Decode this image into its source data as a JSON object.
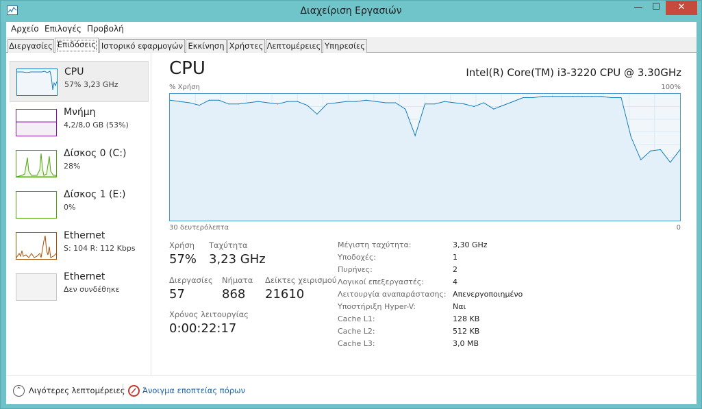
{
  "window": {
    "title": "Διαχείριση Εργασιών",
    "min_glyph": "—",
    "max_glyph": "☐",
    "close_glyph": "✕"
  },
  "menu": [
    {
      "label": "Αρχείο"
    },
    {
      "label": "Επιλογές"
    },
    {
      "label": "Προβολή"
    }
  ],
  "tabs": [
    {
      "label": "Διεργασίες",
      "active": false
    },
    {
      "label": "Επιδόσεις",
      "active": true
    },
    {
      "label": "Ιστορικό εφαρμογών",
      "active": false
    },
    {
      "label": "Εκκίνηση",
      "active": false
    },
    {
      "label": "Χρήστες",
      "active": false
    },
    {
      "label": "Λεπτομέρειες",
      "active": false
    },
    {
      "label": "Υπηρεσίες",
      "active": false
    }
  ],
  "sidebar": [
    {
      "name": "CPU",
      "sub": "57% 3,23 GHz",
      "color": "#117dbb",
      "icon": "cpu-thumbnail"
    },
    {
      "name": "Μνήμη",
      "sub": "4,2/8,0 GB (53%)",
      "color": "#8b12ae",
      "icon": "memory-thumbnail"
    },
    {
      "name": "Δίσκος 0 (C:)",
      "sub": "28%",
      "color": "#4da60c",
      "icon": "disk-thumbnail"
    },
    {
      "name": "Δίσκος 1 (E:)",
      "sub": "0%",
      "color": "#4da60c",
      "icon": "disk-thumbnail"
    },
    {
      "name": "Ethernet",
      "sub": "S: 104  R: 112 Kbps",
      "color": "#a74f01",
      "icon": "ethernet-thumbnail"
    },
    {
      "name": "Ethernet",
      "sub": "Δεν συνδέθηκε",
      "color": "#9c9c9c",
      "icon": "ethernet-thumbnail"
    }
  ],
  "cpu": {
    "title": "CPU",
    "model": "Intel(R) Core(TM) i3-3220 CPU @ 3.30GHz",
    "y_label": "% Χρήση",
    "y_max": "100%",
    "x_label": "30 δευτερόλεπτα",
    "x_min": "0"
  },
  "stats": {
    "usage_label": "Χρήση",
    "usage_value": "57%",
    "speed_label": "Ταχύτητα",
    "speed_value": "3,23 GHz",
    "processes_label": "Διεργασίες",
    "processes_value": "57",
    "threads_label": "Νήματα",
    "threads_value": "868",
    "handles_label": "Δείκτες χειρισμού",
    "handles_value": "21610",
    "uptime_label": "Χρόνος λειτουργίας",
    "uptime_value": "0:00:22:17"
  },
  "info": [
    {
      "label": "Μέγιστη ταχύτητα:",
      "value": "3,30 GHz"
    },
    {
      "label": "Υποδοχές:",
      "value": "1"
    },
    {
      "label": "Πυρήνες:",
      "value": "2"
    },
    {
      "label": "Λογικοί επεξεργαστές:",
      "value": "4"
    },
    {
      "label": "Λειτουργία αναπαράστασης:",
      "value": "Απενεργοποιημένο"
    },
    {
      "label": "Υποστήριξη Hyper-V:",
      "value": "Ναι"
    },
    {
      "label": "Cache L1:",
      "value": "128 KB"
    },
    {
      "label": "Cache L2:",
      "value": "512 KB"
    },
    {
      "label": "Cache L3:",
      "value": "3,0 MB"
    }
  ],
  "footer": {
    "fewer_details": "Λιγότερες λεπτομέρειες",
    "open_monitor": "Άνοιγμα εποπτείας πόρων"
  },
  "chart_data": {
    "type": "area",
    "ylim": [
      0,
      100
    ],
    "xlim": [
      30,
      0
    ],
    "values": [
      95,
      94,
      93,
      91,
      95,
      95,
      92,
      92,
      93,
      94,
      93,
      92,
      94,
      94,
      91,
      84,
      92,
      93,
      94,
      94,
      95,
      94,
      93,
      93,
      88,
      67,
      92,
      92,
      94,
      93,
      92,
      90,
      93,
      88,
      91,
      94,
      97,
      97,
      98,
      98,
      98,
      98,
      98,
      98,
      98,
      97,
      97,
      66,
      48,
      55,
      56,
      46,
      56
    ]
  }
}
